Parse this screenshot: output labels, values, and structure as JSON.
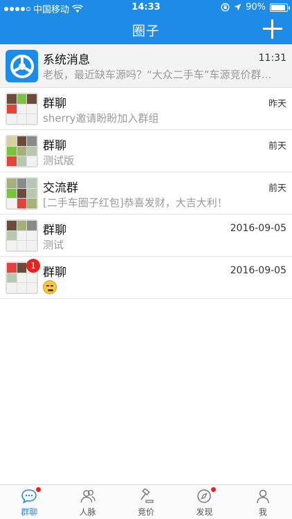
{
  "status_bar": {
    "carrier": "中国移动",
    "time": "14:33",
    "battery": "90%",
    "battery_level": 0.9
  },
  "nav": {
    "title": "圈子"
  },
  "chats": [
    {
      "title": "系统消息",
      "subtitle": "老板，最近缺车源吗？“大众二手车”车源竞价群…",
      "time": "11:31"
    },
    {
      "title": "群聊",
      "subtitle": "sherry邀请盼盼加入群组",
      "time": "昨天"
    },
    {
      "title": "群聊",
      "subtitle": "测试版",
      "time": "前天"
    },
    {
      "title": "交流群",
      "subtitle": "[二手车圈子红包]恭喜发财，大吉大利！",
      "time": "前天"
    },
    {
      "title": "群聊",
      "subtitle": "测试",
      "time": "2016-09-05"
    },
    {
      "title": "群聊",
      "subtitle": "",
      "time": "2016-09-05",
      "badge": "1"
    }
  ],
  "tabs": [
    {
      "label": "群聊",
      "icon": "chat-bubble-icon",
      "active": true,
      "dot": true
    },
    {
      "label": "人脉",
      "icon": "contacts-icon",
      "active": false,
      "dot": false
    },
    {
      "label": "竞价",
      "icon": "gavel-icon",
      "active": false,
      "dot": false
    },
    {
      "label": "发现",
      "icon": "compass-icon",
      "active": false,
      "dot": true
    },
    {
      "label": "我",
      "icon": "person-icon",
      "active": false,
      "dot": false
    }
  ],
  "colors": {
    "brand": "#1e8ce6",
    "badge": "#e5231f",
    "subtitle": "#9a9a9a"
  }
}
